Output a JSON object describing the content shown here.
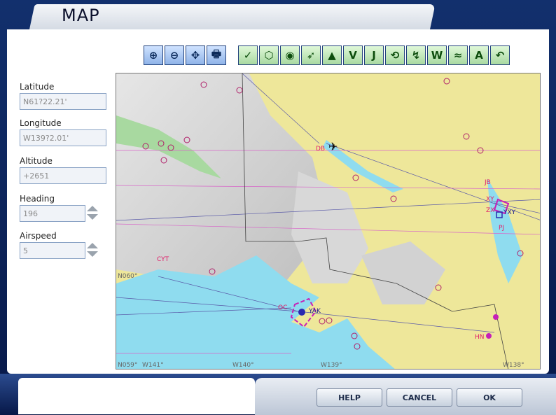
{
  "window": {
    "title": "MAP"
  },
  "toolbar": {
    "nav": [
      {
        "name": "zoom-in-icon",
        "glyph": "⊕"
      },
      {
        "name": "zoom-out-icon",
        "glyph": "⊖"
      },
      {
        "name": "center-icon",
        "glyph": "✥"
      },
      {
        "name": "print-icon",
        "glyph": "🖶"
      }
    ],
    "layers": [
      {
        "name": "airport-icon",
        "glyph": "✓"
      },
      {
        "name": "vor-icon",
        "glyph": "⬡"
      },
      {
        "name": "ndb-icon",
        "glyph": "◉"
      },
      {
        "name": "airplane-icon",
        "glyph": "➶"
      },
      {
        "name": "terrain-icon",
        "glyph": "▲"
      },
      {
        "name": "victor-airways-icon",
        "glyph": "V"
      },
      {
        "name": "jet-airways-icon",
        "glyph": "J"
      },
      {
        "name": "airspace-icon",
        "glyph": "⟲"
      },
      {
        "name": "route-icon",
        "glyph": "↯"
      },
      {
        "name": "waypoint-icon",
        "glyph": "W"
      },
      {
        "name": "hl-icon",
        "glyph": "≈"
      },
      {
        "name": "altitude-icon",
        "glyph": "A"
      },
      {
        "name": "approach-icon",
        "glyph": "↶"
      }
    ]
  },
  "fields": {
    "latitude": {
      "label": "Latitude",
      "value": "N61?22.21'"
    },
    "longitude": {
      "label": "Longitude",
      "value": "W139?2.01'"
    },
    "altitude": {
      "label": "Altitude",
      "value": "+2651"
    },
    "heading": {
      "label": "Heading",
      "value": "196"
    },
    "airspeed": {
      "label": "Airspeed",
      "value": "5"
    }
  },
  "map": {
    "labels": [
      {
        "text": "DB",
        "color": "#e0206a"
      },
      {
        "text": "JB",
        "color": "#e0206a"
      },
      {
        "text": "XY",
        "color": "#e0206a"
      },
      {
        "text": "ZX",
        "color": "#e0206a"
      },
      {
        "text": "YXY",
        "color": "#1a1a8a"
      },
      {
        "text": "PJ",
        "color": "#e0206a"
      },
      {
        "text": "CYT",
        "color": "#e0206a"
      },
      {
        "text": "OC",
        "color": "#e0206a"
      },
      {
        "text": "YAK",
        "color": "#1a1a8a"
      },
      {
        "text": "HN",
        "color": "#e0206a"
      },
      {
        "text": "N060°",
        "color": "#666"
      },
      {
        "text": "N059°",
        "color": "#666"
      },
      {
        "text": "W141°",
        "color": "#666"
      },
      {
        "text": "W140°",
        "color": "#666"
      },
      {
        "text": "W139°",
        "color": "#666"
      },
      {
        "text": "W138°",
        "color": "#666"
      }
    ]
  },
  "buttons": {
    "help": "HELP",
    "cancel": "CANCEL",
    "ok": "OK"
  }
}
